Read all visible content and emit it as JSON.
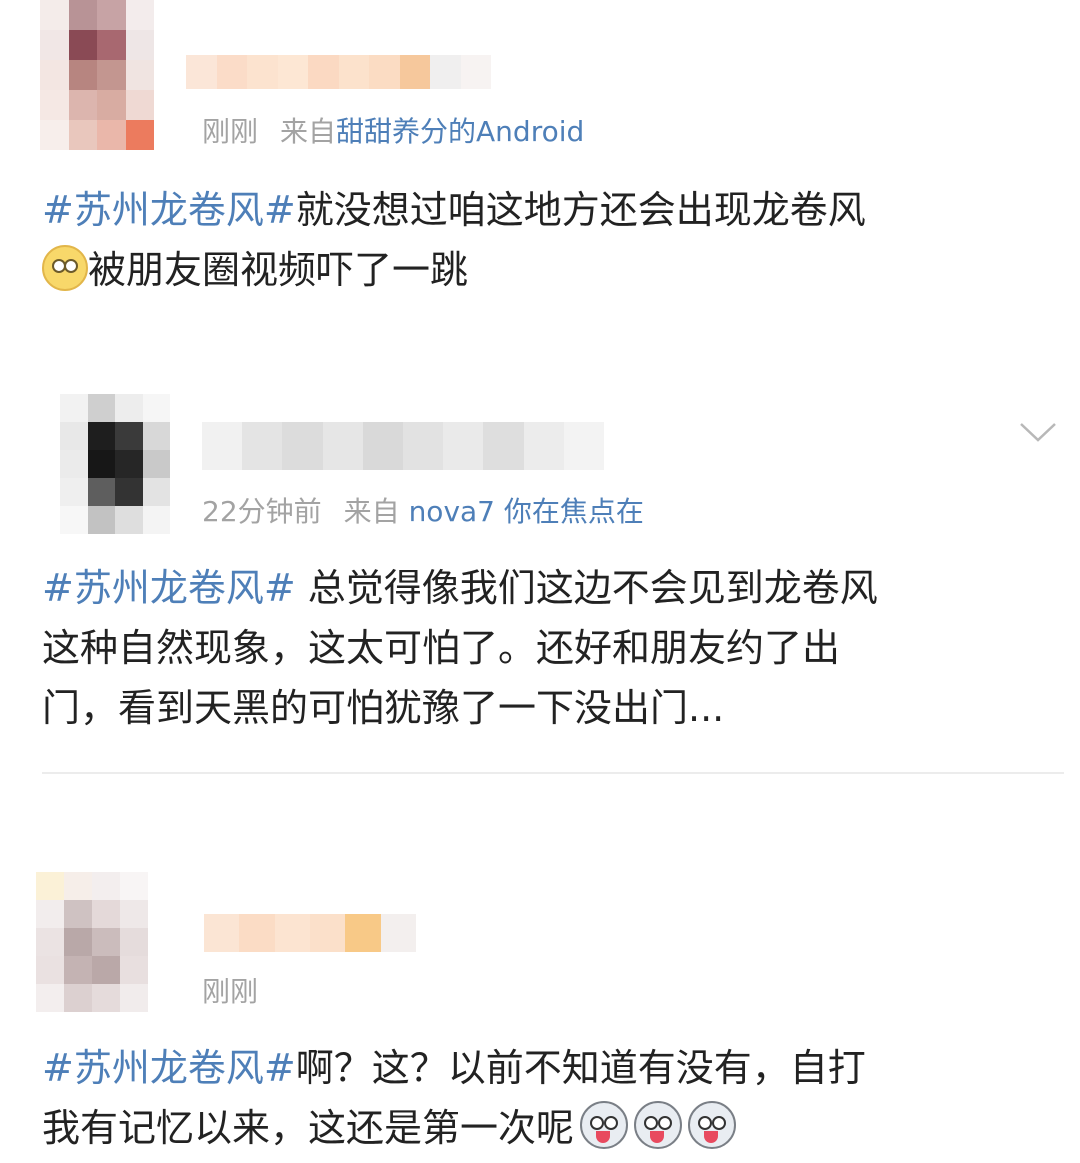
{
  "colors": {
    "topic_link": "#4e7fb8",
    "meta_text": "#a3a3a3",
    "body_text": "#222222",
    "divider": "#ececec"
  },
  "posts": [
    {
      "time": "刚刚",
      "source_prefix": "来自",
      "source_name": "甜甜养分的Android",
      "topic": "#苏州龙卷风#",
      "text_1": "就没想过咱这地方还会出现龙卷风",
      "text_2": "被朋友圈视频吓了一跳",
      "emoji": "smiling-face-icon"
    },
    {
      "time": "22分钟前",
      "source_prefix": "来自",
      "source_name": "nova7 你在焦点在",
      "topic": "#苏州龙卷风#",
      "text_1": " 总觉得像我们这边不会见到龙卷风",
      "text_2": "这种自然现象，这太可怕了。还好和朋友约了出",
      "text_3": "门，看到天黑的可怕犹豫了一下没出门...",
      "menu_icon": "chevron-down-icon"
    },
    {
      "time": "刚刚",
      "topic": "#苏州龙卷风#",
      "text_1": "啊？这？以前不知道有没有，自打",
      "text_2": "我有记忆以来，这还是第一次呢",
      "emoji": "husky-face-icon"
    }
  ]
}
